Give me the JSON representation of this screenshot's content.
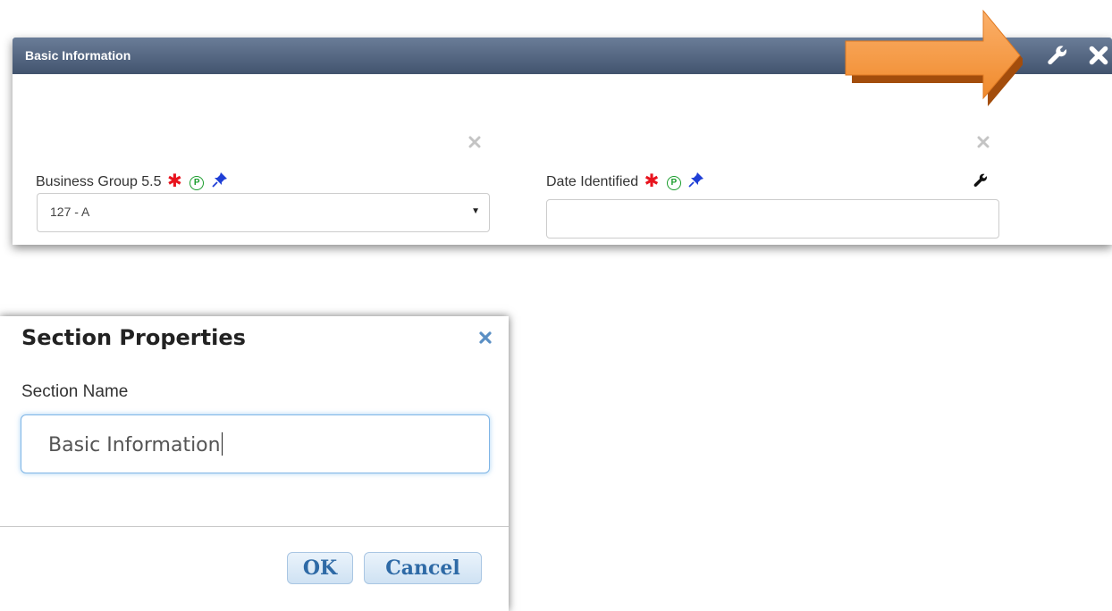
{
  "section": {
    "title": "Basic Information",
    "header_icons": [
      "wrench-icon",
      "close-icon"
    ]
  },
  "fields": [
    {
      "label": "Business Group 5.5",
      "required_marker": "✱",
      "property_badge": "P",
      "type": "select",
      "value": "127 - A"
    },
    {
      "label": "Date Identified",
      "required_marker": "✱",
      "property_badge": "P",
      "type": "text",
      "value": ""
    }
  ],
  "dialog": {
    "title": "Section Properties",
    "field_label": "Section Name",
    "input_value": "Basic Information",
    "ok_label": "OK",
    "cancel_label": "Cancel"
  },
  "colors": {
    "header_bar": "#4d6079",
    "arrow": "#f7943d",
    "required": "#e8141e",
    "property_badge": "#1a9d2c",
    "pin": "#1f3fd6",
    "button_text": "#2e6aa6"
  }
}
